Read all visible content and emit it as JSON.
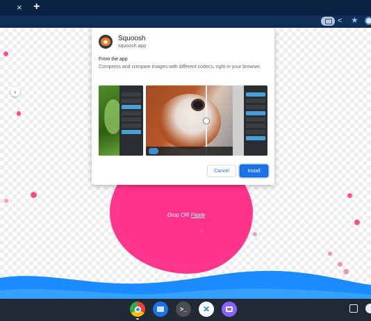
{
  "browser": {
    "tab_close_glyph": "×",
    "new_tab_glyph": "+",
    "toolbar_icons": [
      "install-app-icon",
      "share-icon",
      "bookmark-star-icon",
      "profile-icon"
    ]
  },
  "page": {
    "drop_text": "Drop OR",
    "paste_link": "Paste",
    "accent_color": "#ff2c86",
    "wave_color": "#1a8cff"
  },
  "dialog": {
    "app_name": "Squoosh",
    "app_domain": "squoosh.app",
    "section_title": "From the app",
    "description": "Compress and compare images with different codecs, right in your browser.",
    "cancel_label": "Cancel",
    "install_label": "Install",
    "carousel_prev_glyph": "‹",
    "screenshots": [
      "screenshot-1",
      "screenshot-2"
    ]
  },
  "shelf": {
    "apps": [
      {
        "name": "chrome-icon",
        "color": "#ffffff"
      },
      {
        "name": "files-icon",
        "color": "#1a73e8"
      },
      {
        "name": "terminal-icon",
        "color": "#3c4043"
      },
      {
        "name": "vscode-icon",
        "color": "#ffffff"
      },
      {
        "name": "chat-icon",
        "color": "#7b5cff"
      }
    ],
    "terminal_glyph": ">_"
  }
}
